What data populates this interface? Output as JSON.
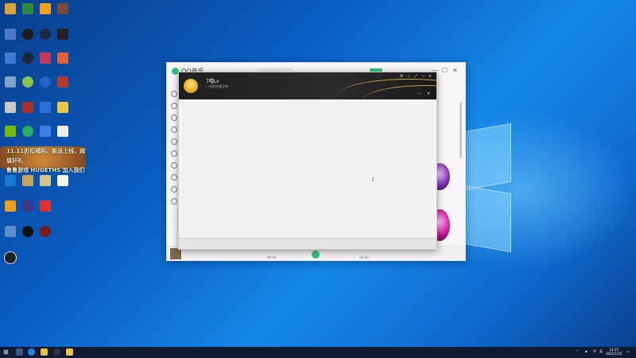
{
  "desktop": {
    "banner_line1": "11.11折扣福利、新品上线、超值好礼",
    "banner_line2": "鲁鲁游戏 HUGETHS 加入我们"
  },
  "main_window": {
    "app_title": "QQ音乐",
    "close_label": "✕",
    "max_label": "☐",
    "min_label": "—",
    "player": {
      "elapsed": "00:00",
      "total": "00:00"
    }
  },
  "overlay_window": {
    "name": "7嘻Lv",
    "subtitle": "一句签名都没有",
    "controls": [
      "⚙",
      "☆",
      "⤢",
      "—",
      "✕"
    ]
  },
  "taskbar": {
    "start_icon": "⊞",
    "time": "14:25",
    "date": "2021/11/5",
    "ime": "中",
    "lang": "英"
  },
  "colors": {
    "accent": "#31c27c"
  }
}
